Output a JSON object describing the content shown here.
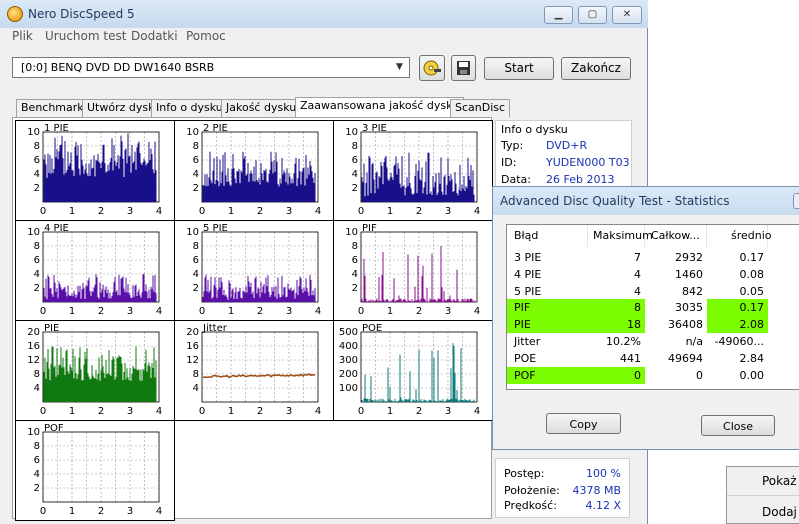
{
  "window": {
    "title": "Nero DiscSpeed 5"
  },
  "menu": [
    "Plik",
    "Uruchom test",
    "Dodatki",
    "Pomoc"
  ],
  "toolbar": {
    "drive": "[0:0]   BENQ DVD DD DW1640 BSRB",
    "start_label": "Start",
    "end_label": "Zakończ"
  },
  "tabs": [
    "Benchmark",
    "Utwórz dysk",
    "Info o dysku",
    "Jakość dysku",
    "Zaawansowana jakość dysku",
    "ScanDisc"
  ],
  "active_tab": 4,
  "charts": [
    {
      "label": "1 PIE",
      "color": "#1a0f8a",
      "yticks": [
        "10",
        "8",
        "6",
        "4",
        "2"
      ],
      "xticks": [
        "0",
        "1",
        "2",
        "3",
        "4"
      ],
      "max": 10,
      "kind": "bar",
      "level": 3.4,
      "spread": 6.5
    },
    {
      "label": "2 PIE",
      "color": "#1a0f8a",
      "yticks": [
        "10",
        "8",
        "6",
        "4",
        "2"
      ],
      "xticks": [
        "0",
        "1",
        "2",
        "3",
        "4"
      ],
      "max": 10,
      "kind": "bar",
      "level": 2.2,
      "spread": 5
    },
    {
      "label": "3 PIE",
      "color": "#1a0f8a",
      "yticks": [
        "10",
        "8",
        "6",
        "4",
        "2"
      ],
      "xticks": [
        "0",
        "1",
        "2",
        "3",
        "4"
      ],
      "max": 10,
      "kind": "bar",
      "level": 0.8,
      "spread": 6.5
    },
    {
      "label": "4 PIE",
      "color": "#5a10a8",
      "yticks": [
        "10",
        "8",
        "6",
        "4",
        "2"
      ],
      "xticks": [
        "0",
        "1",
        "2",
        "3",
        "4"
      ],
      "max": 10,
      "kind": "bar",
      "level": 0.4,
      "spread": 3.6
    },
    {
      "label": "5 PIE",
      "color": "#5a10a8",
      "yticks": [
        "10",
        "8",
        "6",
        "4",
        "2"
      ],
      "xticks": [
        "0",
        "1",
        "2",
        "3",
        "4"
      ],
      "max": 10,
      "kind": "bar",
      "level": 0.3,
      "spread": 3.6
    },
    {
      "label": "PIF",
      "color": "#8a1090",
      "yticks": [
        "10",
        "8",
        "6",
        "4",
        "2"
      ],
      "xticks": [
        "0",
        "1",
        "2",
        "3",
        "4"
      ],
      "max": 10,
      "kind": "spike",
      "level": 0.5,
      "spread": 7.5
    },
    {
      "label": "PIE",
      "color": "#107a10",
      "yticks": [
        "20",
        "16",
        "12",
        "8",
        "4"
      ],
      "xticks": [
        "0",
        "1",
        "2",
        "3",
        "4"
      ],
      "max": 20,
      "kind": "bar",
      "level": 6,
      "spread": 10
    },
    {
      "label": "Jitter",
      "color": "#a0501a",
      "yticks": [
        "20",
        "16",
        "12",
        "8",
        "4"
      ],
      "xticks": [
        "0",
        "1",
        "2",
        "3",
        "4"
      ],
      "max": 20,
      "kind": "line",
      "level": 7.2,
      "spread": 0.6
    },
    {
      "label": "POE",
      "color": "#0f7a7a",
      "yticks": [
        "500",
        "400",
        "300",
        "200",
        "100"
      ],
      "xticks": [
        "0",
        "1",
        "2",
        "3",
        "4"
      ],
      "max": 500,
      "kind": "spike",
      "level": 25,
      "spread": 420
    },
    {
      "label": "POF",
      "color": "#1a0f8a",
      "yticks": [
        "10",
        "8",
        "6",
        "4",
        "2"
      ],
      "xticks": [
        "0",
        "1",
        "2",
        "3",
        "4"
      ],
      "max": 10,
      "kind": "none",
      "level": 0,
      "spread": 0
    }
  ],
  "info": {
    "group_title": "Info o dysku",
    "rows": [
      {
        "label": "Typ:",
        "value": "DVD+R"
      },
      {
        "label": "ID:",
        "value": "YUDEN000 T03"
      },
      {
        "label": "Data:",
        "value": "26 Feb 2013"
      }
    ]
  },
  "progress": {
    "rows": [
      {
        "label": "Postęp:",
        "value": "100 %"
      },
      {
        "label": "Położenie:",
        "value": "4378 MB"
      },
      {
        "label": "Prędkość:",
        "value": "4.12 X"
      }
    ]
  },
  "dialog": {
    "title": "Advanced Disc Quality Test - Statistics",
    "headers": [
      "Błąd",
      "Maksimum",
      "Całkow...",
      "średnio"
    ],
    "rows": [
      {
        "name": "3 PIE",
        "max": "7",
        "total": "2932",
        "avg": "0.17",
        "hl": []
      },
      {
        "name": "4 PIE",
        "max": "4",
        "total": "1460",
        "avg": "0.08",
        "hl": []
      },
      {
        "name": "5 PIE",
        "max": "4",
        "total": "842",
        "avg": "0.05",
        "hl": []
      },
      {
        "name": "PIF",
        "max": "8",
        "total": "3035",
        "avg": "0.17",
        "hl": [
          "name",
          "max",
          "avg"
        ]
      },
      {
        "name": "PIE",
        "max": "18",
        "total": "36408",
        "avg": "2.08",
        "hl": [
          "name",
          "max",
          "avg"
        ]
      },
      {
        "name": "Jitter",
        "max": "10.2%",
        "total": "n/a",
        "avg": "-49060...",
        "hl": []
      },
      {
        "name": "POE",
        "max": "441",
        "total": "49694",
        "avg": "2.84",
        "hl": []
      },
      {
        "name": "POF",
        "max": "0",
        "total": "0",
        "avg": "0.00",
        "hl": [
          "name",
          "max"
        ]
      }
    ],
    "copy_label": "Copy",
    "close_label": "Close",
    "highlight_color": "#7cfc00"
  },
  "popup": {
    "items": [
      "Pokaż",
      "Dodaj"
    ]
  }
}
